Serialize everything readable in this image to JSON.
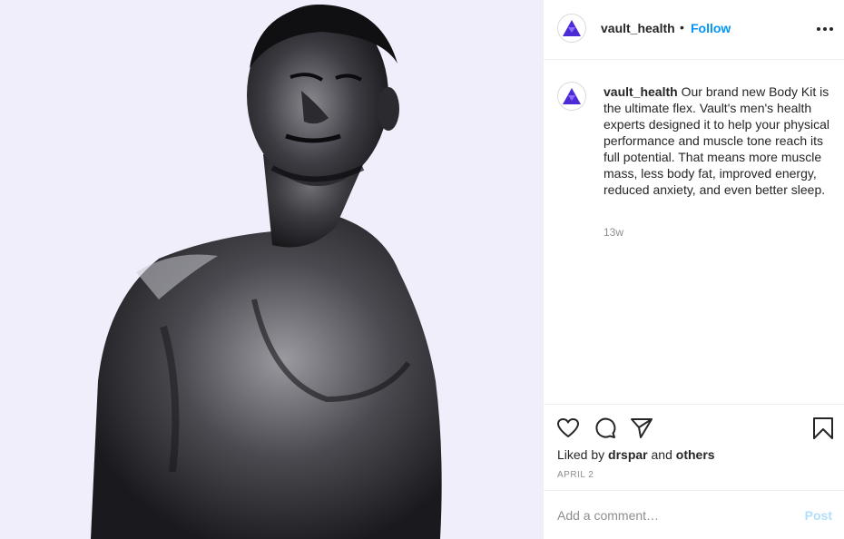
{
  "post": {
    "image_alt": "Black and white portrait of a shirtless man looking upward against a pale lavender background",
    "username": "vault_health",
    "follow_label": "Follow",
    "separator": "•",
    "caption_username": "vault_health",
    "caption_text": "Our brand new Body Kit is the ultimate flex. Vault's men's health experts designed it to help your physical performance and muscle tone reach its full potential. That means more muscle mass, less body fat, improved energy, reduced anxiety, and even better sleep.",
    "time_ago": "13w",
    "liked_by_prefix": "Liked by",
    "liked_by_user": "drspar",
    "liked_by_and": "and",
    "liked_by_others": "others",
    "date": "APRIL 2"
  },
  "comment": {
    "placeholder": "Add a comment…",
    "post_label": "Post"
  },
  "icons": {
    "more": "more-horizontal-icon",
    "like": "heart-icon",
    "comment": "comment-icon",
    "share": "paper-plane-icon",
    "save": "bookmark-icon",
    "avatar": "vault-triangle-logo"
  },
  "colors": {
    "follow": "#0095f6",
    "post_disabled": "#b2dffc",
    "photo_bg": "#f1eefb",
    "brand_purple": "#4b2bd6"
  }
}
